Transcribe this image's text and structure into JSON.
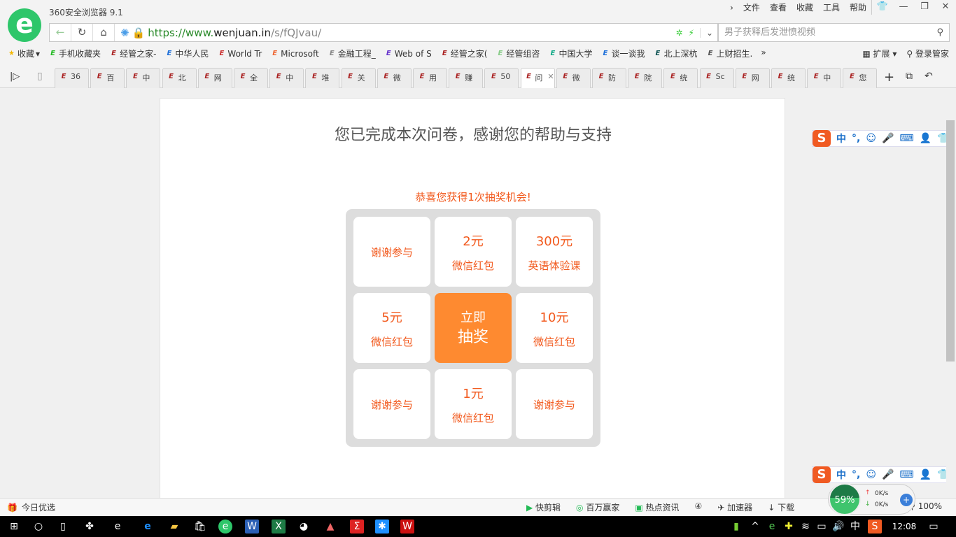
{
  "app": {
    "title": "360安全浏览器 9.1",
    "menu": [
      "文件",
      "查看",
      "收藏",
      "工具",
      "帮助"
    ]
  },
  "address": {
    "scheme": "https://www.",
    "domain": "wenjuan.in",
    "path": "/s/fQJvau/"
  },
  "search": {
    "placeholder": "男子获释后发泄愤视频"
  },
  "bookmarks": [
    "收藏",
    "手机收藏夹",
    "经管之家-",
    "中华人民",
    "World Tr",
    "Microsoft",
    "金融工程_",
    "Web of S",
    "经管之家(",
    "经管组咨",
    "中国大学",
    "谈一谈我",
    "北上深杭",
    "上财招生."
  ],
  "bookmarks_right": {
    "ext": "扩展",
    "login": "登录管家"
  },
  "tabs": [
    "36",
    "百",
    "中",
    "北",
    "网",
    "全",
    "中",
    "堆",
    "关",
    "微",
    "用",
    "赚",
    "50",
    "问",
    "微",
    "防",
    "院",
    "统",
    "Sc",
    "网",
    "统",
    "中",
    "您"
  ],
  "active_tab": 13,
  "page": {
    "title": "您已完成本次问卷，感谢您的帮助与支持",
    "lottery_msg": "恭喜您获得1次抽奖机会!",
    "cells": [
      {
        "amt": "",
        "label": "谢谢参与"
      },
      {
        "amt": "2元",
        "label": "微信红包"
      },
      {
        "amt": "300元",
        "label": "英语体验课"
      },
      {
        "amt": "5元",
        "label": "微信红包"
      },
      {
        "amt": "立即",
        "label": "抽奖"
      },
      {
        "amt": "10元",
        "label": "微信红包"
      },
      {
        "amt": "",
        "label": "谢谢参与"
      },
      {
        "amt": "1元",
        "label": "微信红包"
      },
      {
        "amt": "",
        "label": "谢谢参与"
      }
    ]
  },
  "ime": {
    "mode": "中",
    "punct": "°,"
  },
  "status": {
    "left": "今日优选",
    "items": [
      "快剪辑",
      "百万赢家",
      "热点资讯",
      "加速器",
      "下载"
    ],
    "zoom": "100%"
  },
  "speed": {
    "percent": "59%",
    "up": "0K/s",
    "down": "0K/s"
  },
  "taskbar": {
    "ime": "中",
    "time": "12:08"
  }
}
